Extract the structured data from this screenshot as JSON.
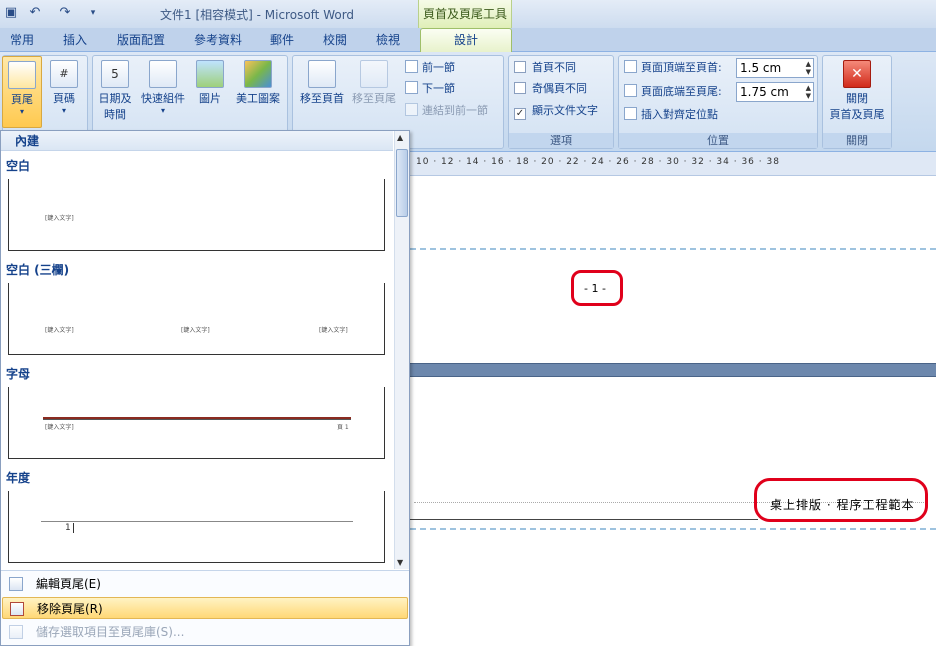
{
  "window": {
    "title": "文件1 [相容模式] - Microsoft Word",
    "tool_context": "頁首及頁尾工具"
  },
  "tabs": [
    "常用",
    "插入",
    "版面配置",
    "參考資料",
    "郵件",
    "校閱",
    "檢視"
  ],
  "active_tab": "設計",
  "ribbon": {
    "header_footer": {
      "footer": "頁尾",
      "page_number": "頁碼"
    },
    "insert": {
      "date_time_1": "日期及",
      "date_time_2": "時間",
      "quick_parts": "快速組件",
      "picture": "圖片",
      "clip_art": "美工圖案"
    },
    "navigation": {
      "goto_header": "移至頁首",
      "goto_footer": "移至頁尾",
      "prev_section": "前一節",
      "next_section": "下一節",
      "link_previous": "連結到前一節"
    },
    "options": {
      "label": "選項",
      "diff_first": "首頁不同",
      "diff_odd_even": "奇偶頁不同",
      "show_doc_text": "顯示文件文字",
      "show_doc_text_checked": "✓"
    },
    "position": {
      "label": "位置",
      "header_from_top": "頁面頂端至頁首:",
      "header_value": "1.5 cm",
      "footer_from_bottom": "頁面底端至頁尾:",
      "footer_value": "1.75 cm",
      "insert_align_tab": "插入對齊定位點"
    },
    "close": {
      "label": "關閉",
      "btn_1": "關閉",
      "btn_2": "頁首及頁尾"
    }
  },
  "ruler": {
    "ticks": "10 · 12 · 14 · 16 · 18 · 20 · 22 · 24 · 26 · 28 · 30 · 32 · 34 · 36 · 38"
  },
  "document": {
    "page_number": "- 1 -",
    "footer_text": "桌上排版 · 程序工程範本"
  },
  "gallery": {
    "header": "內建",
    "sections": [
      {
        "label": "空白",
        "placeholders": [
          "[鍵入文字]"
        ]
      },
      {
        "label": "空白 (三欄)",
        "placeholders": [
          "[鍵入文字]",
          "[鍵入文字]",
          "[鍵入文字]"
        ]
      },
      {
        "label": "字母",
        "placeholders": [
          "[鍵入文字]",
          "頁 1"
        ]
      },
      {
        "label": "年度",
        "placeholders": [
          "1"
        ]
      }
    ],
    "menu": {
      "edit_footer": "編輯頁尾(E)",
      "remove_footer": "移除頁尾(R)",
      "save_selection": "儲存選取項目至頁尾庫(S)..."
    }
  },
  "colors": {
    "accent": "#15428b",
    "highlight": "#ffd876",
    "callout": "#e0001b"
  }
}
